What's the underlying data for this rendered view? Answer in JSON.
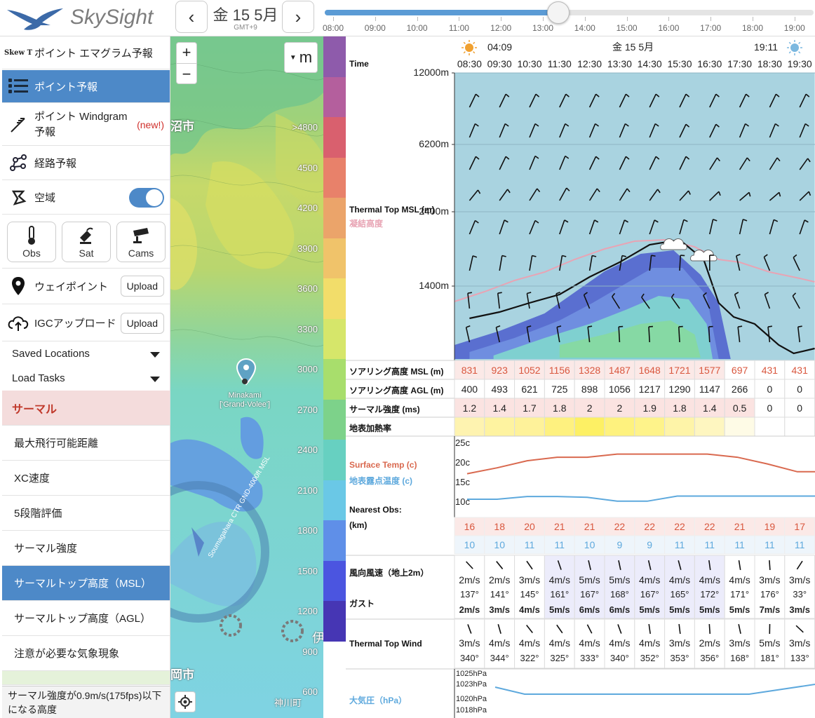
{
  "header": {
    "logo_text": "SkySight",
    "date": "金 15 5月",
    "timezone": "GMT+9",
    "prev_icon": "chevron-left-icon",
    "next_icon": "chevron-right-icon",
    "time_ticks": [
      "08:00",
      "09:00",
      "10:00",
      "11:00",
      "12:00",
      "13:00",
      "14:00",
      "15:00",
      "16:00",
      "17:00",
      "18:00",
      "19:00"
    ],
    "slider_position": 0.5
  },
  "sidebar": {
    "items": [
      {
        "label": "ポイント エマグラム予報",
        "icon": "skew-t-icon",
        "icon_text": "Skew T"
      },
      {
        "label": "ポイント予報",
        "icon": "list-icon",
        "selected": true
      },
      {
        "label": "ポイント Windgram 予報",
        "icon": "windgram-icon",
        "badge": "(new!)"
      },
      {
        "label": "経路予報",
        "icon": "route-icon"
      },
      {
        "label": "空域",
        "icon": "airspace-icon",
        "toggle": true
      }
    ],
    "buttons": [
      {
        "label": "Obs",
        "icon": "thermometer-icon"
      },
      {
        "label": "Sat",
        "icon": "satellite-icon"
      },
      {
        "label": "Cams",
        "icon": "camera-icon"
      }
    ],
    "waypoint_label": "ウェイポイント",
    "igc_label": "IGCアップロード",
    "upload_label": "Upload",
    "saved_locations": "Saved Locations",
    "load_tasks": "Load Tasks",
    "section_title": "サーマル",
    "layers": [
      "最大飛行可能距離",
      "XC速度",
      "5段階評価",
      "サーマル強度",
      "サーマルトップ高度（MSL）",
      "サーマルトップ高度（AGL）",
      "注意が必要な気象現象"
    ],
    "selected_layer_index": 4,
    "tooltip": "サーマル強度が0.9m/s(175fps)以下になる高度"
  },
  "map": {
    "unit_button": "m",
    "zoom_in": "+",
    "zoom_out": "−",
    "place_label": "Minakami\n['Grand-Volee']",
    "town_labels": [
      "沼市",
      "岡市",
      "神川町",
      "伊"
    ],
    "airspace_label": "Soumagahara CTR  GND-4000ft MSL",
    "scale_labels": [
      ">4800",
      "4500",
      "4200",
      "3900",
      "3600",
      "3300",
      "3000",
      "2700",
      "2400",
      "2100",
      "1800",
      "1500",
      "1200",
      "900",
      "600"
    ],
    "scale_colors": [
      "#8e5bab",
      "#b45f9d",
      "#d9606e",
      "#e8816a",
      "#eba46a",
      "#f0c36a",
      "#f2dd6a",
      "#d6e66a",
      "#a8de6c",
      "#7dd28a",
      "#67d0c1",
      "#6ac8e6",
      "#5f8fe8",
      "#4b55e0",
      "#4636b4"
    ]
  },
  "forecast": {
    "date_label": "金 15 5月",
    "sunrise": "04:09",
    "sunset": "19:11",
    "time_label": "Time",
    "times": [
      "08:30",
      "09:30",
      "10:30",
      "11:30",
      "12:30",
      "13:30",
      "14:30",
      "15:30",
      "16:30",
      "17:30",
      "18:30",
      "19:30"
    ],
    "alt_labels": [
      "12000m",
      "6200m",
      "2400m",
      "1400m"
    ],
    "thermal_top_label": "Thermal Top MSL (m)",
    "cloudbase_label": "凝結高度",
    "rows": {
      "soaring_msl": {
        "label": "ソアリング高度 MSL (m)",
        "values": [
          831,
          923,
          1052,
          1156,
          1328,
          1487,
          1648,
          1721,
          1577,
          697,
          431,
          431
        ]
      },
      "soaring_agl": {
        "label": "ソアリング高度 AGL (m)",
        "values": [
          400,
          493,
          621,
          725,
          898,
          1056,
          1217,
          1290,
          1147,
          266,
          0,
          0
        ]
      },
      "thermal_strength": {
        "label": "サーマル強度 (ms)",
        "values": [
          1.2,
          1.4,
          1.7,
          1.8,
          2,
          2,
          1.9,
          1.8,
          1.4,
          0.5,
          0,
          0
        ]
      },
      "surface_heating": {
        "label": "地表加熱率"
      }
    },
    "temp": {
      "surface_label": "Surface Temp (c)",
      "dew_label": "地表露点温度 (c)",
      "axis_labels": [
        "25c",
        "20c",
        "15c",
        "10c"
      ],
      "nearest_obs": "Nearest Obs:",
      "km": "(km)",
      "surface_values": [
        16,
        18,
        20,
        21,
        21,
        22,
        22,
        22,
        22,
        21,
        19,
        17
      ],
      "dew_values": [
        10,
        10,
        11,
        11,
        10,
        9,
        9,
        11,
        11,
        11,
        11,
        11
      ]
    },
    "wind2m": {
      "label": "風向風速（地上2m）",
      "gust_label": "ガスト",
      "speed": [
        "2m/s",
        "2m/s",
        "3m/s",
        "4m/s",
        "5m/s",
        "5m/s",
        "4m/s",
        "4m/s",
        "4m/s",
        "4m/s",
        "3m/s",
        "3m/s"
      ],
      "dir": [
        "137°",
        "141°",
        "145°",
        "161°",
        "167°",
        "168°",
        "167°",
        "165°",
        "172°",
        "171°",
        "176°",
        "33°"
      ],
      "dir_deg": [
        137,
        141,
        145,
        161,
        167,
        168,
        167,
        165,
        172,
        171,
        176,
        33
      ],
      "gust": [
        "2m/s",
        "3m/s",
        "4m/s",
        "5m/s",
        "6m/s",
        "6m/s",
        "5m/s",
        "5m/s",
        "5m/s",
        "5m/s",
        "7m/s",
        "3m/s"
      ]
    },
    "tt_wind": {
      "label": "Thermal Top Wind",
      "speed": [
        "3m/s",
        "4m/s",
        "4m/s",
        "4m/s",
        "4m/s",
        "4m/s",
        "4m/s",
        "3m/s",
        "2m/s",
        "3m/s",
        "5m/s",
        "3m/s"
      ],
      "dir": [
        "340°",
        "344°",
        "322°",
        "325°",
        "333°",
        "340°",
        "352°",
        "353°",
        "356°",
        "168°",
        "181°",
        "133°"
      ],
      "dir_deg": [
        340,
        344,
        322,
        325,
        333,
        340,
        352,
        353,
        356,
        168,
        181,
        133
      ]
    },
    "pressure": {
      "label": "大気圧（hPa）",
      "axis_labels": [
        "1025hPa",
        "1023hPa",
        "1020hPa",
        "1018hPa"
      ]
    }
  },
  "chart_data": {
    "type": "line",
    "title": "",
    "x": [
      "08:30",
      "09:30",
      "10:30",
      "11:30",
      "12:30",
      "13:30",
      "14:30",
      "15:30",
      "16:30",
      "17:30",
      "18:30",
      "19:30"
    ],
    "series": [
      {
        "name": "Surface Temp (c)",
        "values": [
          16.5,
          18,
          19.8,
          20.7,
          20.7,
          21.5,
          21.5,
          21.5,
          21.5,
          20.7,
          19,
          17
        ],
        "color": "#d9694f"
      },
      {
        "name": "地表露点温度 (c)",
        "values": [
          10,
          10,
          10.7,
          10.7,
          10.5,
          9.5,
          9.5,
          10.8,
          10.8,
          10.8,
          10.8,
          10.8
        ],
        "color": "#5ea9dd"
      }
    ],
    "ylim": [
      8,
      25
    ]
  }
}
